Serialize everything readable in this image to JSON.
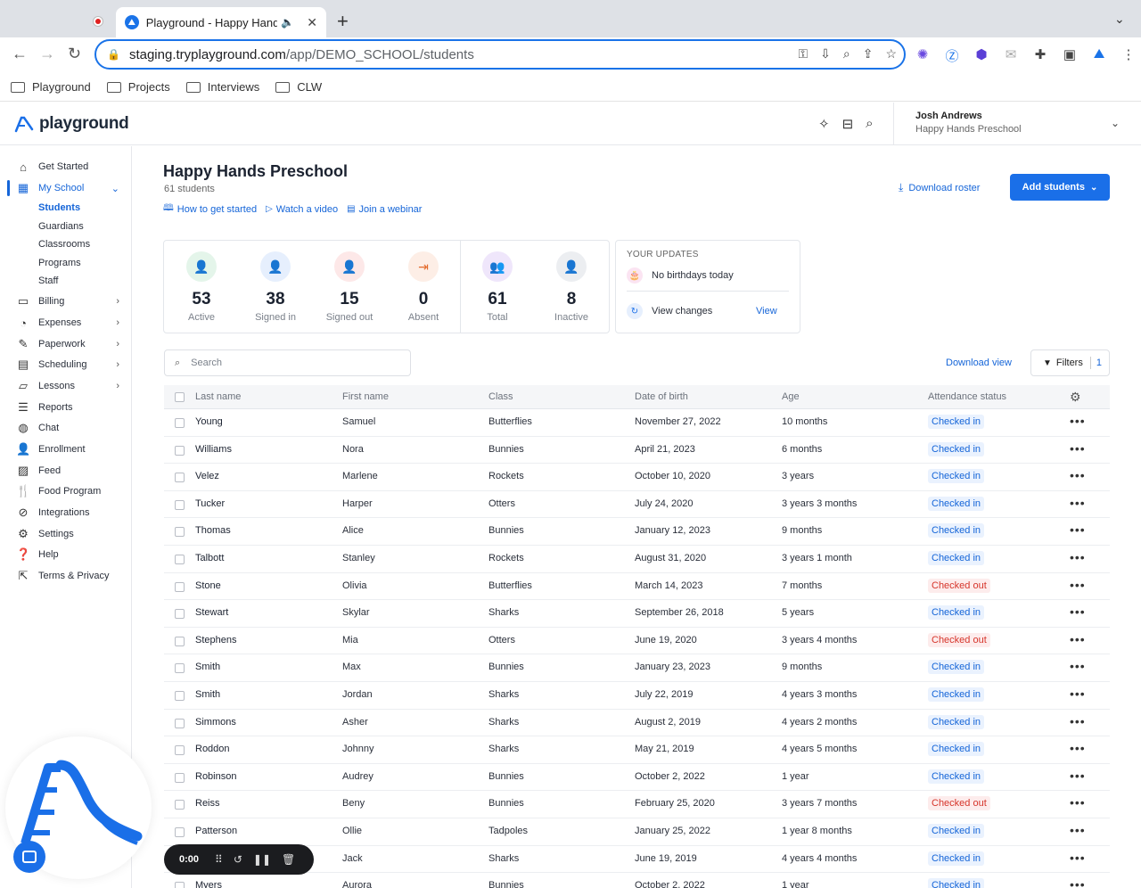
{
  "browser": {
    "tab_title": "Playground - Happy Hand",
    "url_host": "staging.tryplayground.com",
    "url_path": "/app/DEMO_SCHOOL/students",
    "bookmarks": [
      "Playground",
      "Projects",
      "Interviews",
      "CLW"
    ]
  },
  "app": {
    "logo_text": "playground",
    "user_name": "Josh Andrews",
    "user_school": "Happy Hands Preschool"
  },
  "sidebar": {
    "items": [
      {
        "label": "Get Started",
        "icon": "home-icon"
      },
      {
        "label": "My School",
        "icon": "school-icon"
      },
      {
        "label": "Billing",
        "icon": "billing-icon"
      },
      {
        "label": "Expenses",
        "icon": "expenses-icon"
      },
      {
        "label": "Paperwork",
        "icon": "paperwork-icon"
      },
      {
        "label": "Scheduling",
        "icon": "calendar-icon"
      },
      {
        "label": "Lessons",
        "icon": "folder-icon"
      },
      {
        "label": "Reports",
        "icon": "reports-icon"
      },
      {
        "label": "Chat",
        "icon": "chat-icon"
      },
      {
        "label": "Enrollment",
        "icon": "enrollment-icon"
      },
      {
        "label": "Feed",
        "icon": "feed-icon"
      },
      {
        "label": "Food Program",
        "icon": "food-icon"
      },
      {
        "label": "Integrations",
        "icon": "link-icon"
      },
      {
        "label": "Settings",
        "icon": "gear-icon"
      },
      {
        "label": "Help",
        "icon": "help-icon"
      },
      {
        "label": "Terms & Privacy",
        "icon": "external-link-icon"
      }
    ],
    "sub_items": [
      "Students",
      "Guardians",
      "Classrooms",
      "Programs",
      "Staff"
    ]
  },
  "page": {
    "title": "Happy Hands Preschool",
    "count": "61 students",
    "links": [
      "How to get started",
      "Watch a video",
      "Join a webinar"
    ],
    "download_roster": "Download roster",
    "add_students": "Add students"
  },
  "stats": [
    {
      "value": "53",
      "label": "Active"
    },
    {
      "value": "38",
      "label": "Signed in"
    },
    {
      "value": "15",
      "label": "Signed out"
    },
    {
      "value": "0",
      "label": "Absent"
    },
    {
      "value": "61",
      "label": "Total"
    },
    {
      "value": "8",
      "label": "Inactive"
    }
  ],
  "updates": {
    "title": "YOUR UPDATES",
    "birthday": "No birthdays today",
    "changes": "View changes",
    "view": "View"
  },
  "table": {
    "search_placeholder": "Search",
    "download_view": "Download view",
    "filters_label": "Filters",
    "filters_count": "1",
    "headers": [
      "Last name",
      "First name",
      "Class",
      "Date of birth",
      "Age",
      "Attendance status"
    ],
    "rows": [
      {
        "last": "Young",
        "first": "Samuel",
        "class": "Butterflies",
        "dob": "November 27, 2022",
        "age": "10 months",
        "status": "Checked in"
      },
      {
        "last": "Williams",
        "first": "Nora",
        "class": "Bunnies",
        "dob": "April 21, 2023",
        "age": "6 months",
        "status": "Checked in"
      },
      {
        "last": "Velez",
        "first": "Marlene",
        "class": "Rockets",
        "dob": "October 10, 2020",
        "age": "3 years",
        "status": "Checked in"
      },
      {
        "last": "Tucker",
        "first": "Harper",
        "class": "Otters",
        "dob": "July 24, 2020",
        "age": "3 years 3 months",
        "status": "Checked in"
      },
      {
        "last": "Thomas",
        "first": "Alice",
        "class": "Bunnies",
        "dob": "January 12, 2023",
        "age": "9 months",
        "status": "Checked in"
      },
      {
        "last": "Talbott",
        "first": "Stanley",
        "class": "Rockets",
        "dob": "August 31, 2020",
        "age": "3 years 1 month",
        "status": "Checked in"
      },
      {
        "last": "Stone",
        "first": "Olivia",
        "class": "Butterflies",
        "dob": "March 14, 2023",
        "age": "7 months",
        "status": "Checked out"
      },
      {
        "last": "Stewart",
        "first": "Skylar",
        "class": "Sharks",
        "dob": "September 26, 2018",
        "age": "5 years",
        "status": "Checked in"
      },
      {
        "last": "Stephens",
        "first": "Mia",
        "class": "Otters",
        "dob": "June 19, 2020",
        "age": "3 years 4 months",
        "status": "Checked out"
      },
      {
        "last": "Smith",
        "first": "Max",
        "class": "Bunnies",
        "dob": "January 23, 2023",
        "age": "9 months",
        "status": "Checked in"
      },
      {
        "last": "Smith",
        "first": "Jordan",
        "class": "Sharks",
        "dob": "July 22, 2019",
        "age": "4 years 3 months",
        "status": "Checked in"
      },
      {
        "last": "Simmons",
        "first": "Asher",
        "class": "Sharks",
        "dob": "August 2, 2019",
        "age": "4 years 2 months",
        "status": "Checked in"
      },
      {
        "last": "Roddon",
        "first": "Johnny",
        "class": "Sharks",
        "dob": "May 21, 2019",
        "age": "4 years 5 months",
        "status": "Checked in"
      },
      {
        "last": "Robinson",
        "first": "Audrey",
        "class": "Bunnies",
        "dob": "October 2, 2022",
        "age": "1 year",
        "status": "Checked in"
      },
      {
        "last": "Reiss",
        "first": "Beny",
        "class": "Bunnies",
        "dob": "February 25, 2020",
        "age": "3 years 7 months",
        "status": "Checked out"
      },
      {
        "last": "Patterson",
        "first": "Ollie",
        "class": "Tadpoles",
        "dob": "January 25, 2022",
        "age": "1 year 8 months",
        "status": "Checked in"
      },
      {
        "last": "",
        "first": "Jack",
        "class": "Sharks",
        "dob": "June 19, 2019",
        "age": "4 years 4 months",
        "status": "Checked in"
      },
      {
        "last": "Myers",
        "first": "Aurora",
        "class": "Bunnies",
        "dob": "October 2, 2022",
        "age": "1 year",
        "status": "Checked in"
      }
    ]
  },
  "recorder": {
    "time": "0:00"
  },
  "colors": {
    "accent": "#1a6fe8",
    "checked_in": "#1565d8",
    "checked_out": "#d6352b"
  }
}
